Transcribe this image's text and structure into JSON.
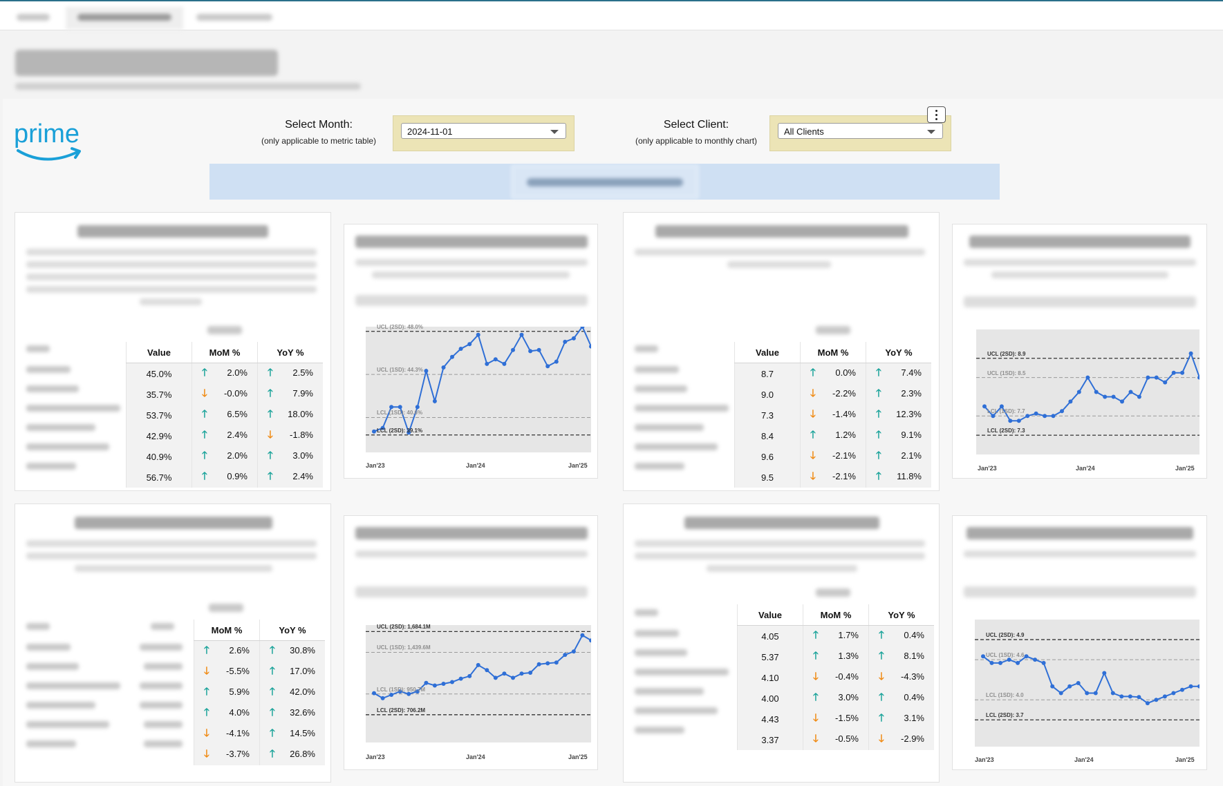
{
  "controls": {
    "month_label": "Select Month:",
    "month_note": "(only applicable to metric table)",
    "month_value": "2024-11-01",
    "client_label": "Select Client:",
    "client_note": "(only applicable to monthly chart)",
    "client_value": "All Clients"
  },
  "brand": {
    "logo_text": "prime",
    "accent": "#1aa0d8"
  },
  "colors": {
    "up": "#1ba39a",
    "down": "#f08a12",
    "line": "#2f6fd6",
    "banner": "#cfe0f3",
    "selector_bg": "#ece4b6"
  },
  "tables": [
    {
      "headers": {
        "value": "Value",
        "mom": "MoM %",
        "yoy": "YoY %"
      },
      "rows": [
        {
          "value": "45.0%",
          "mom": "2.0%",
          "mom_dir": "up",
          "yoy": "2.5%",
          "yoy_dir": "up"
        },
        {
          "value": "35.7%",
          "mom": "-0.0%",
          "mom_dir": "down",
          "yoy": "7.9%",
          "yoy_dir": "up"
        },
        {
          "value": "53.7%",
          "mom": "6.5%",
          "mom_dir": "up",
          "yoy": "18.0%",
          "yoy_dir": "up"
        },
        {
          "value": "42.9%",
          "mom": "2.4%",
          "mom_dir": "up",
          "yoy": "-1.8%",
          "yoy_dir": "down"
        },
        {
          "value": "40.9%",
          "mom": "2.0%",
          "mom_dir": "up",
          "yoy": "3.0%",
          "yoy_dir": "up"
        },
        {
          "value": "56.7%",
          "mom": "0.9%",
          "mom_dir": "up",
          "yoy": "2.4%",
          "yoy_dir": "up"
        }
      ]
    },
    {
      "headers": {
        "value": "Value",
        "mom": "MoM %",
        "yoy": "YoY %"
      },
      "rows": [
        {
          "value": "8.7",
          "mom": "0.0%",
          "mom_dir": "up",
          "yoy": "7.4%",
          "yoy_dir": "up"
        },
        {
          "value": "9.0",
          "mom": "-2.2%",
          "mom_dir": "down",
          "yoy": "2.3%",
          "yoy_dir": "up"
        },
        {
          "value": "7.3",
          "mom": "-1.4%",
          "mom_dir": "down",
          "yoy": "12.3%",
          "yoy_dir": "up"
        },
        {
          "value": "8.4",
          "mom": "1.2%",
          "mom_dir": "up",
          "yoy": "9.1%",
          "yoy_dir": "up"
        },
        {
          "value": "9.6",
          "mom": "-2.1%",
          "mom_dir": "down",
          "yoy": "2.1%",
          "yoy_dir": "up"
        },
        {
          "value": "9.5",
          "mom": "-2.1%",
          "mom_dir": "down",
          "yoy": "11.8%",
          "yoy_dir": "up"
        }
      ]
    },
    {
      "headers": {
        "mom": "MoM %",
        "yoy": "YoY %"
      },
      "rows": [
        {
          "mom": "2.6%",
          "mom_dir": "up",
          "yoy": "30.8%",
          "yoy_dir": "up"
        },
        {
          "mom": "-5.5%",
          "mom_dir": "down",
          "yoy": "17.0%",
          "yoy_dir": "up"
        },
        {
          "mom": "5.9%",
          "mom_dir": "up",
          "yoy": "42.0%",
          "yoy_dir": "up"
        },
        {
          "mom": "4.0%",
          "mom_dir": "up",
          "yoy": "32.6%",
          "yoy_dir": "up"
        },
        {
          "mom": "-4.1%",
          "mom_dir": "down",
          "yoy": "14.5%",
          "yoy_dir": "up"
        },
        {
          "mom": "-3.7%",
          "mom_dir": "down",
          "yoy": "26.8%",
          "yoy_dir": "up"
        }
      ]
    },
    {
      "headers": {
        "value": "Value",
        "mom": "MoM %",
        "yoy": "YoY %"
      },
      "rows": [
        {
          "value": "4.05",
          "mom": "1.7%",
          "mom_dir": "up",
          "yoy": "0.4%",
          "yoy_dir": "up"
        },
        {
          "value": "5.37",
          "mom": "1.3%",
          "mom_dir": "up",
          "yoy": "8.1%",
          "yoy_dir": "up"
        },
        {
          "value": "4.10",
          "mom": "-0.4%",
          "mom_dir": "down",
          "yoy": "-4.3%",
          "yoy_dir": "down"
        },
        {
          "value": "4.00",
          "mom": "3.0%",
          "mom_dir": "up",
          "yoy": "0.4%",
          "yoy_dir": "up"
        },
        {
          "value": "4.43",
          "mom": "-1.5%",
          "mom_dir": "down",
          "yoy": "3.1%",
          "yoy_dir": "up"
        },
        {
          "value": "3.37",
          "mom": "-0.5%",
          "mom_dir": "down",
          "yoy": "-2.9%",
          "yoy_dir": "down"
        }
      ]
    }
  ],
  "chart_data": [
    {
      "type": "line",
      "x_ticks": [
        "Jan'23",
        "Jan'24",
        "Jan'25"
      ],
      "control_lines": {
        "ucl2": "UCL (2SD): 48.0%",
        "ucl1": "UCL (1SD): 44.3%",
        "lcl1": "LCL (1SD): 40.6%",
        "lcl2": "LCL (2SD): 39.1%"
      },
      "limits": {
        "ucl2": 48.0,
        "ucl1": 44.3,
        "lcl1": 40.6,
        "lcl2": 39.1
      },
      "ylim": [
        37.6,
        48.4
      ],
      "values": [
        39.4,
        39.7,
        41.5,
        41.5,
        39.3,
        41.5,
        44.6,
        42.0,
        44.9,
        45.8,
        46.5,
        46.9,
        47.7,
        45.2,
        45.6,
        45.2,
        46.4,
        47.7,
        46.3,
        46.4,
        45.0,
        45.4,
        47.1,
        47.4,
        48.4,
        46.7
      ]
    },
    {
      "type": "line",
      "x_ticks": [
        "Jan'23",
        "Jan'24",
        "Jan'25"
      ],
      "control_lines": {
        "ucl2": "UCL (2SD): 8.9",
        "ucl1": "UCL (1SD): 8.5",
        "lcl1": "LCL (1SD): 7.7",
        "lcl2": "LCL (2SD): 7.3"
      },
      "limits": {
        "ucl2": 8.9,
        "ucl1": 8.5,
        "lcl1": 7.7,
        "lcl2": 7.3
      },
      "ylim": [
        6.9,
        9.5
      ],
      "values": [
        7.9,
        7.7,
        7.9,
        7.6,
        7.6,
        7.7,
        7.75,
        7.7,
        7.7,
        7.8,
        8.0,
        8.2,
        8.5,
        8.2,
        8.1,
        8.1,
        8.0,
        8.2,
        8.1,
        8.5,
        8.5,
        8.4,
        8.6,
        8.6,
        9.0,
        8.5
      ]
    },
    {
      "type": "line",
      "x_ticks": [
        "Jan'23",
        "Jan'24",
        "Jan'25"
      ],
      "control_lines": {
        "ucl2": "UCL (2SD): 1,684.1M",
        "ucl1": "UCL (1SD): 1,439.6M",
        "lcl1": "LCL (1SD): 950.7M",
        "lcl2": "LCL (2SD): 706.2M"
      },
      "limits": {
        "ucl2": 1684.1,
        "ucl1": 1439.6,
        "lcl1": 950.7,
        "lcl2": 706.2
      },
      "ylim": [
        380,
        1760
      ],
      "values": [
        960,
        900,
        940,
        980,
        950,
        980,
        1080,
        1050,
        1070,
        1090,
        1130,
        1160,
        1290,
        1230,
        1140,
        1190,
        1140,
        1190,
        1200,
        1300,
        1310,
        1320,
        1410,
        1450,
        1640,
        1580
      ]
    },
    {
      "type": "line",
      "x_ticks": [
        "Jan'23",
        "Jan'24",
        "Jan'25"
      ],
      "control_lines": {
        "ucl2": "UCL (2SD): 4.9",
        "ucl1": "UCL (1SD): 4.6",
        "lcl1": "LCL (1SD): 4.0",
        "lcl2": "LCL (2SD): 3.7"
      },
      "limits": {
        "ucl2": 4.9,
        "ucl1": 4.6,
        "lcl1": 4.0,
        "lcl2": 3.7
      },
      "ylim": [
        3.3,
        5.2
      ],
      "values": [
        4.65,
        4.55,
        4.55,
        4.6,
        4.55,
        4.65,
        4.6,
        4.55,
        4.2,
        4.1,
        4.2,
        4.25,
        4.1,
        4.1,
        4.4,
        4.1,
        4.05,
        4.05,
        4.04,
        3.95,
        4.0,
        4.05,
        4.1,
        4.15,
        4.2,
        4.2
      ]
    }
  ]
}
